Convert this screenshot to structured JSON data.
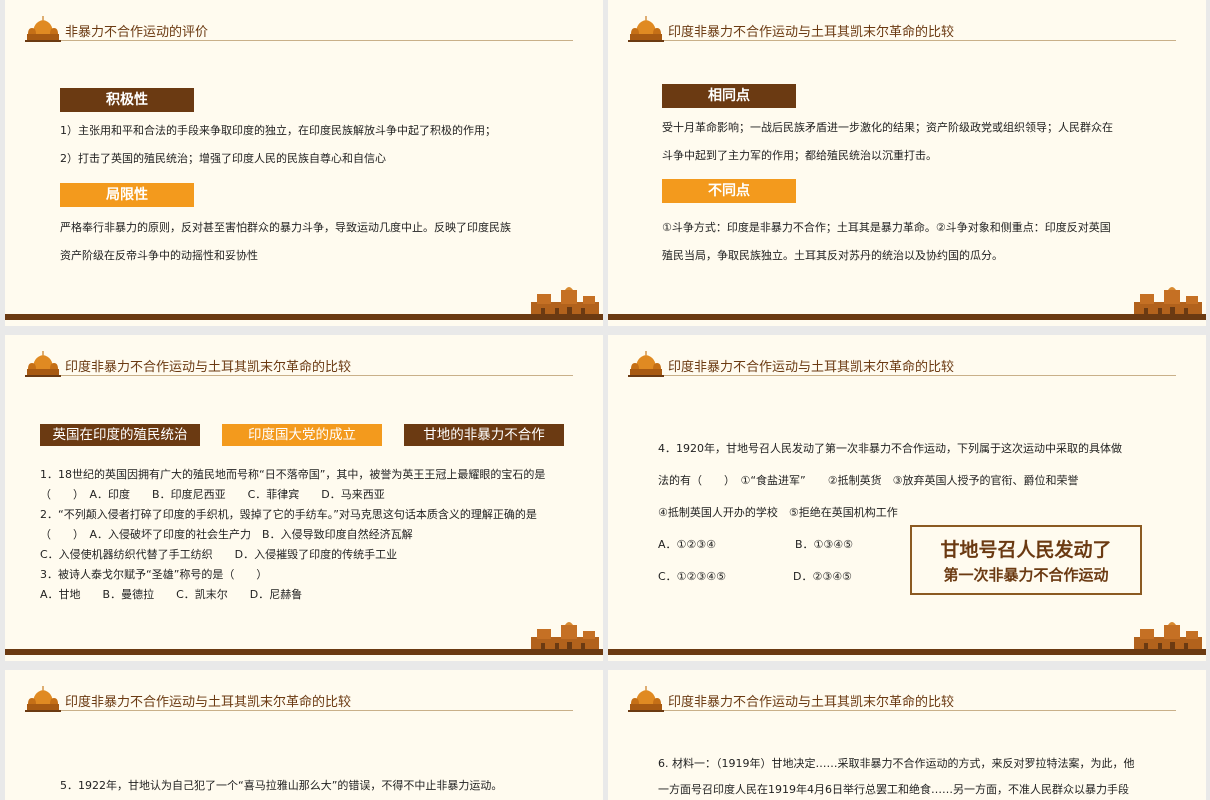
{
  "slides": [
    {
      "title": "非暴力不合作运动的评价",
      "positive": {
        "label": "积极性",
        "lines": [
          "1）主张用和平和合法的手段来争取印度的独立，在印度民族解放斗争中起了积极的作用；",
          "2）打击了英国的殖民统治；增强了印度人民的民族自尊心和自信心"
        ]
      },
      "limitation": {
        "label": "局限性",
        "lines": [
          "严格奉行非暴力的原则，反对甚至害怕群众的暴力斗争，导致运动几度中止。反映了印度民族",
          "资产阶级在反帝斗争中的动摇性和妥协性"
        ]
      }
    },
    {
      "title": "印度非暴力不合作运动与土耳其凯末尔革命的比较",
      "same": {
        "label": "相同点",
        "lines": [
          "受十月革命影响；一战后民族矛盾进一步激化的结果；资产阶级政党或组织领导；人民群众在",
          "斗争中起到了主力军的作用；都给殖民统治以沉重打击。"
        ]
      },
      "diff": {
        "label": "不同点",
        "lines": [
          "①斗争方式：印度是非暴力不合作；土耳其是暴力革命。②斗争对象和侧重点：印度反对英国",
          "殖民当局，争取民族独立。土耳其反对苏丹的统治以及协约国的瓜分。"
        ]
      }
    },
    {
      "title": "印度非暴力不合作运动与土耳其凯末尔革命的比较",
      "tabs": [
        "英国在印度的殖民统治",
        "印度国大党的成立",
        "甘地的非暴力不合作"
      ],
      "lines": [
        "1．18世纪的英国因拥有广大的殖民地而号称“日不落帝国”，其中，被誉为英王王冠上最耀眼的宝石的是",
        "（　　）　A．印度　　B．印度尼西亚　　C．菲律宾　　D．马来西亚",
        "2．“不列颠入侵者打碎了印度的手织机，毁掉了它的手纺车。”对马克思这句话本质含义的理解正确的是",
        "（　　）　A．入侵破坏了印度的社会生产力　B．入侵导致印度自然经济瓦解",
        "C．入侵使机器纺织代替了手工纺织　　D．入侵摧毁了印度的传统手工业",
        "3．被诗人泰戈尔赋予“圣雄”称号的是（　　）",
        "A．甘地　　B．曼德拉　　C．凯末尔　　D．尼赫鲁"
      ]
    },
    {
      "title": "印度非暴力不合作运动与土耳其凯末尔革命的比较",
      "question": [
        "4．1920年，甘地号召人民发动了第一次非暴力不合作运动，下列属于这次运动中采取的具体做",
        "法的有（　　）　①“食盐进军”　　②抵制英货　③放弃英国人授予的官衔、爵位和荣誉",
        "④抵制英国人开办的学校　⑤拒绝在英国机构工作"
      ],
      "options": [
        "A．①②③④",
        "B．①③④⑤",
        "C．①②③④⑤",
        "D．②③④⑤"
      ],
      "callout": [
        "甘地号召人民发动了",
        "第一次非暴力不合作运动"
      ]
    },
    {
      "title": "印度非暴力不合作运动与土耳其凯末尔革命的比较",
      "line": "5．1922年，甘地认为自己犯了一个“喜马拉雅山那么大”的错误，不得不中止非暴力运动。"
    },
    {
      "title": "印度非暴力不合作运动与土耳其凯末尔革命的比较",
      "lines": [
        "6. 材料一：（1919年）甘地决定……采取非暴力不合作运动的方式，来反对罗拉特法案，为此，他",
        "一方面号召印度人民在1919年4月6日举行总罢工和绝食……另一方面，不准人民群众以暴力手段"
      ]
    }
  ],
  "colors": {
    "brown": "#6b3a12",
    "orange": "#f39a1d",
    "background": "#fffbef"
  }
}
